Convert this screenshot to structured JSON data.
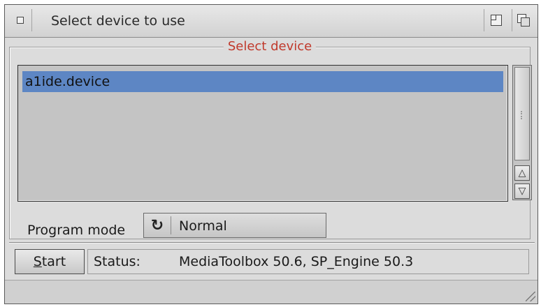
{
  "window": {
    "title": "Select device to use"
  },
  "group": {
    "title": "Select device"
  },
  "device_list": {
    "items": [
      {
        "label": "a1ide.device",
        "selected": true
      }
    ]
  },
  "program_mode": {
    "label": "Program mode",
    "value": "Normal",
    "icon": "cycle-icon"
  },
  "start_button": {
    "label_prefix": "S",
    "label_rest": "tart"
  },
  "status": {
    "label": "Status:",
    "value": "MediaToolbox 50.6, SP_Engine 50.3"
  },
  "colors": {
    "selection": "#5d86c4",
    "group_title": "#c0392b",
    "window_bg": "#dcdcdc"
  }
}
